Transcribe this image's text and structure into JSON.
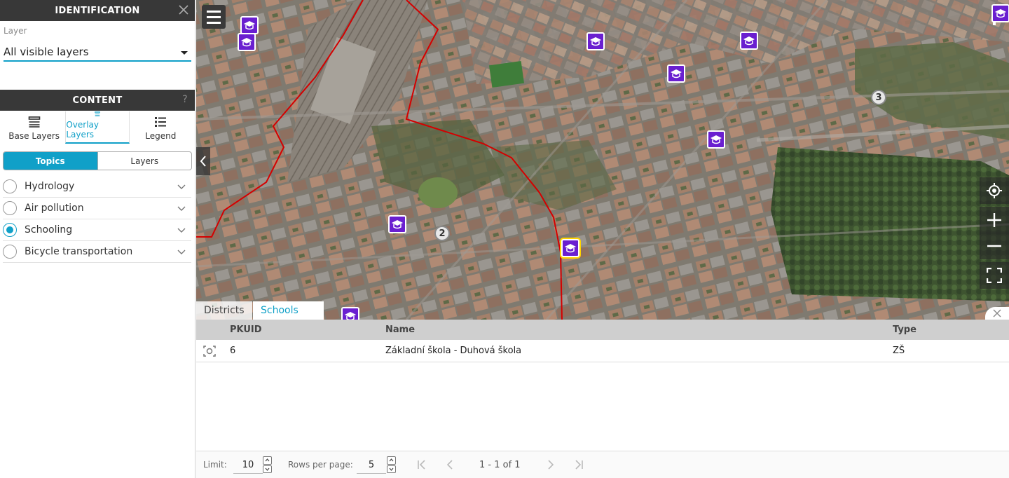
{
  "identification": {
    "title": "IDENTIFICATION",
    "layer_label": "Layer",
    "layer_value": "All visible layers"
  },
  "content": {
    "title": "CONTENT",
    "help": "?",
    "tabs": [
      "Base Layers",
      "Overlay Layers",
      "Legend"
    ],
    "active_tab": "Overlay Layers",
    "segments": [
      "Topics",
      "Layers"
    ],
    "active_segment": "Topics",
    "topics": [
      {
        "label": "Hydrology",
        "checked": false
      },
      {
        "label": "Air pollution",
        "checked": false
      },
      {
        "label": "Schooling",
        "checked": true
      },
      {
        "label": "Bicycle transportation",
        "checked": false
      }
    ]
  },
  "map": {
    "clusters": [
      "3",
      "2"
    ],
    "accent_color": "#10a0c8",
    "school_marker_color": "#6a1fd0",
    "boundary_color": "#d40000"
  },
  "table": {
    "tabs": [
      "Districts",
      "Schools"
    ],
    "active_tab": "Schools",
    "columns": [
      "PKUID",
      "Name",
      "Type"
    ],
    "rows": [
      {
        "pkuid": "6",
        "name": "Základní škola - Duhová škola",
        "type": "ZŠ"
      }
    ],
    "footer": {
      "limit_label": "Limit:",
      "limit_value": "10",
      "rows_label": "Rows per page:",
      "rows_value": "5",
      "range": "1 - 1 of 1"
    }
  }
}
